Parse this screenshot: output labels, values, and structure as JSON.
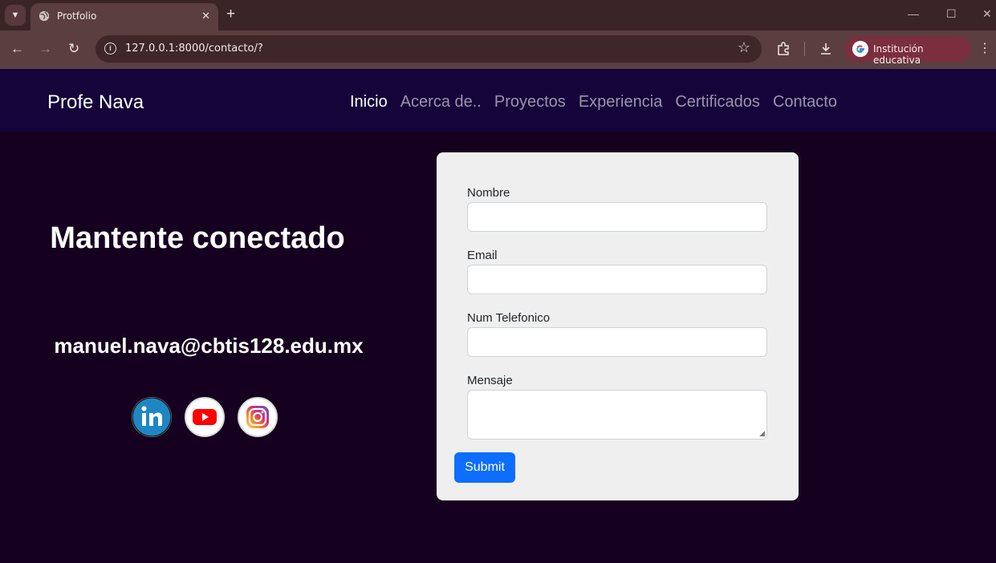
{
  "browser": {
    "tab_title": "Protfolio",
    "tab_close": "✕",
    "new_tab": "+",
    "url": "127.0.0.1:8000/contacto/?",
    "profile_label": "Institución educativa",
    "icons": [
      "tab-menu-icon",
      "globe-icon",
      "back-icon",
      "forward-icon",
      "reload-icon",
      "info-icon",
      "star-icon",
      "extensions-icon",
      "download-icon",
      "google-icon",
      "menu-icon"
    ]
  },
  "nav": {
    "brand": "Profe Nava",
    "links": [
      "Inicio",
      "Acerca de..",
      "Proyectos",
      "Experiencia",
      "Certificados",
      "Contacto"
    ],
    "active": "Inicio"
  },
  "contact": {
    "headline": "Mantente conectado",
    "email": "manuel.nava@cbtis128.edu.mx",
    "social_icons": [
      "linkedin-icon",
      "youtube-icon",
      "instagram-icon"
    ]
  },
  "form": {
    "name_label": "Nombre",
    "email_label": "Email",
    "phone_label": "Num Telefonico",
    "message_label": "Mensaje",
    "submit_label": "Submit"
  },
  "colors": {
    "page_bg": "#160020",
    "navbar_bg": "#14043a",
    "card_bg": "#efefef",
    "accent": "#0d6efd"
  }
}
